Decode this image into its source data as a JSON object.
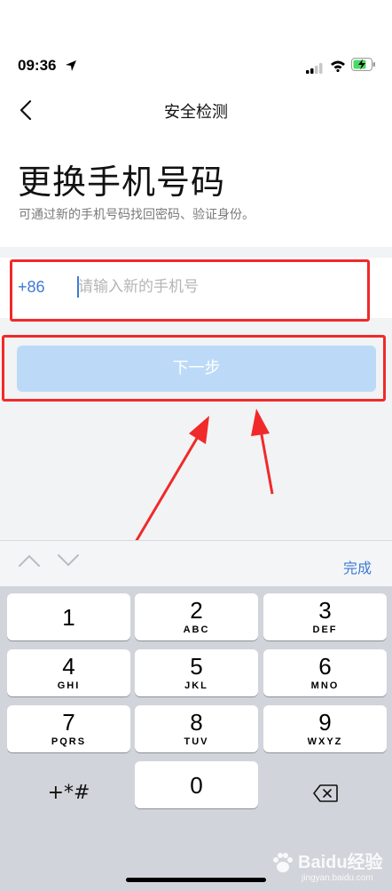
{
  "status_bar": {
    "time": "09:36"
  },
  "nav": {
    "title": "安全检测"
  },
  "header": {
    "title": "更换手机号码",
    "subtitle": "可通过新的手机号码找回密码、验证身份。"
  },
  "phone": {
    "prefix": "+86",
    "placeholder": "请输入新的手机号",
    "value": ""
  },
  "next_button": {
    "label": "下一步",
    "color": "#bcdaf7"
  },
  "highlight_color": "#f02a2a",
  "keyboard": {
    "done_label": "完成",
    "keys": [
      {
        "num": "1",
        "letters": ""
      },
      {
        "num": "2",
        "letters": "ABC"
      },
      {
        "num": "3",
        "letters": "DEF"
      },
      {
        "num": "4",
        "letters": "GHI"
      },
      {
        "num": "5",
        "letters": "JKL"
      },
      {
        "num": "6",
        "letters": "MNO"
      },
      {
        "num": "7",
        "letters": "PQRS"
      },
      {
        "num": "8",
        "letters": "TUV"
      },
      {
        "num": "9",
        "letters": "WXYZ"
      }
    ],
    "symbols": "+*#",
    "zero": "0"
  },
  "watermark": {
    "text": "Baidu经验",
    "sub": "jingyan.baidu.com"
  },
  "colors": {
    "accent": "#3d7ad6",
    "annotation": "#f02a2a"
  }
}
